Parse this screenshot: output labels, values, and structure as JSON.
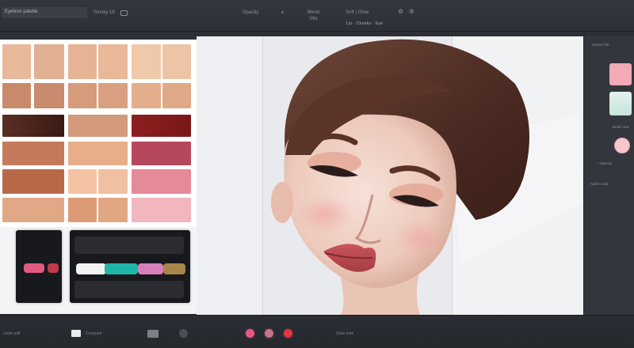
{
  "topbar": {
    "search_text": "Eyeliner palette",
    "item_1": "Smoky 18",
    "item_2": "Opacity",
    "item_3": "Blend",
    "item_4": "Mix",
    "item_5": "Soft | Glow"
  },
  "canvas_header": "Lip · Cheeks · Eye",
  "inspector": {
    "section_title": "Swatch list",
    "size_label": "Brush size",
    "opacity_label": "+ Opacity",
    "add_label": "Add to look"
  },
  "bottombar": {
    "left_label": "Undo edit",
    "mid_label": "Compare",
    "right_label": "Save look"
  },
  "colors": {
    "accent_pink": "#e25a82",
    "lip": "#c85a63",
    "blush": "#f4c2c5"
  },
  "icons": [
    "search-icon",
    "gear-icon",
    "toggle-icon",
    "grid-icon",
    "compare-icon",
    "record-icon"
  ]
}
